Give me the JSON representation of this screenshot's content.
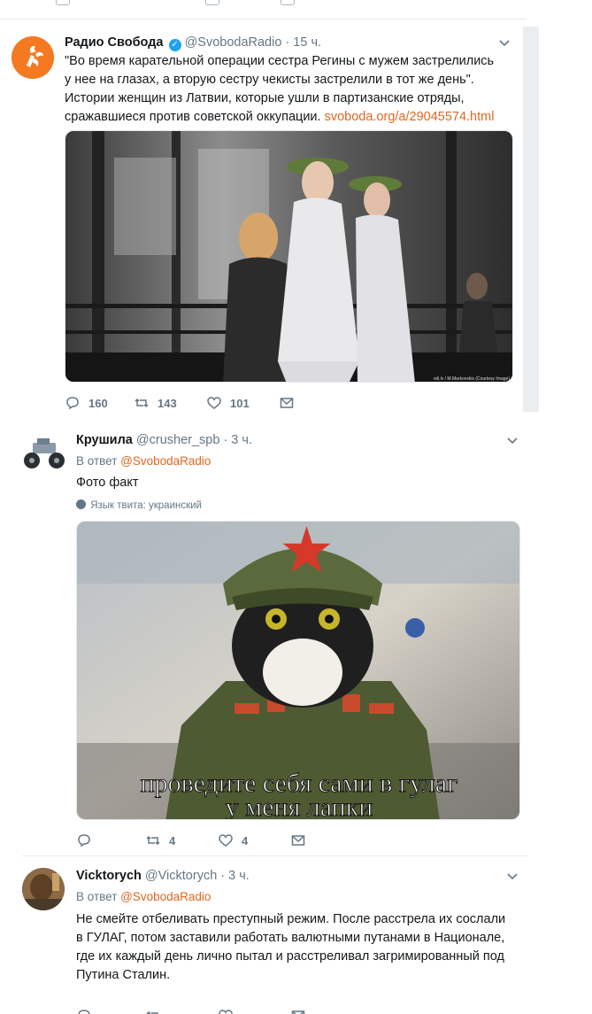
{
  "tweets": [
    {
      "name": "Радио Свобода",
      "handle": "@SvobodaRadio",
      "time": "· 15 ч.",
      "text_main": "\"Во время карательной операции сестра Регины с мужем застрелились у нее на глазах, а вторую сестру чекисты застрелили в тот же день\". Истории женщин из Латвии, которые ушли в партизанские отряды, сражавшиеся против советской оккупации. ",
      "text_link": "svoboda.org/a/29045574.html",
      "media_credit": "vdi.lv / M.Markovskis (Courtesy Image)",
      "actions": {
        "replies": "160",
        "retweets": "143",
        "likes": "101"
      },
      "verified": true
    },
    {
      "name": "Крушила",
      "handle": "@crusher_spb",
      "time": "· 3 ч.",
      "reply_prefix": "В ответ ",
      "reply_to": "@SvobodaRadio",
      "text": "Фото факт",
      "lang_label": "Язык твита: украинский",
      "caption_line1": "проведите себя сами в гулаг",
      "caption_line2": "у меня лапки",
      "actions": {
        "replies": "",
        "retweets": "4",
        "likes": "4"
      }
    },
    {
      "name": "Vicktorych",
      "handle": "@Vicktorych",
      "time": "· 3 ч.",
      "reply_prefix": "В ответ ",
      "reply_to": "@SvobodaRadio",
      "text": "Не смейте отбеливать преступный режим. После расстрела их сослали в ГУЛАГ, потом заставили работать валютными путанами в Национале, где их каждый день лично пытал и расстреливал загримированный под Путина Сталин."
    }
  ],
  "colors": {
    "link": "#e0671f",
    "muted": "#657786",
    "verified": "#1da1f2",
    "rfe_logo": "#f47920"
  }
}
